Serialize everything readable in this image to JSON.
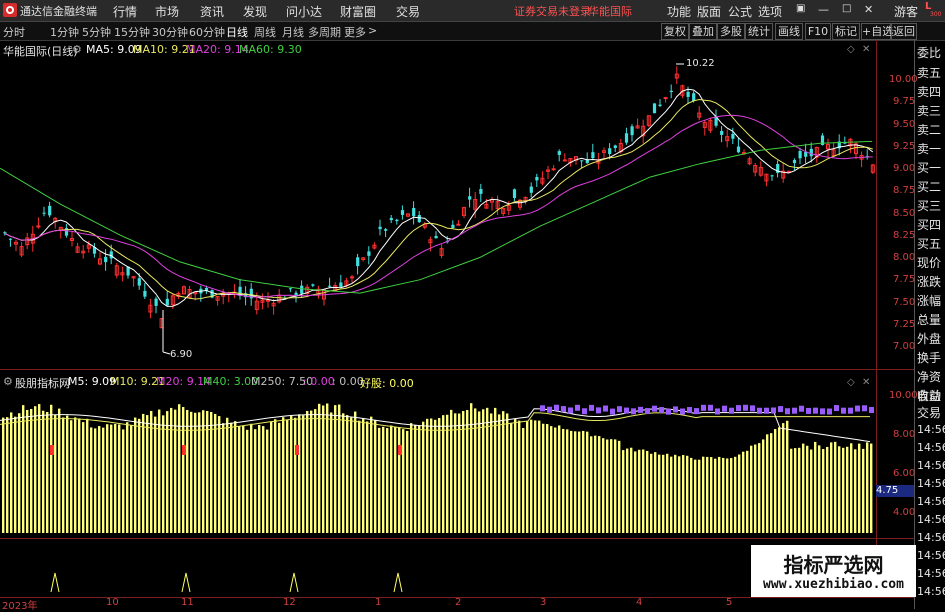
{
  "app": {
    "title": "通达信金融终端",
    "menu": [
      "行情",
      "市场",
      "资讯",
      "发现",
      "问小达",
      "财富圈",
      "交易"
    ],
    "status": "证券交易未登录",
    "stock_name": "华能国际",
    "right_menu": [
      "功能",
      "版面",
      "公式",
      "选项"
    ],
    "guest": "游客",
    "corner": "L",
    "corner_sub": "300"
  },
  "toolbar": {
    "periods": [
      "分时",
      "1分钟",
      "5分钟",
      "15分钟",
      "30分钟",
      "60分钟",
      "日线",
      "周线",
      "月线",
      "多周期",
      "更多"
    ],
    "active_period": "日线",
    "more_arrow": ">",
    "buttons": [
      "复权",
      "叠加",
      "多股",
      "统计",
      "画线",
      "F10",
      "标记",
      "+自选",
      "返回"
    ]
  },
  "main_panel": {
    "title": "华能国际(日线)",
    "ma": [
      {
        "label": "MA5: 9.09",
        "color": "#ffffff"
      },
      {
        "label": "MA10: 9.21",
        "color": "#e8e860"
      },
      {
        "label": "MA20: 9.14",
        "color": "#e040e0"
      },
      {
        "label": "MA60: 9.30",
        "color": "#40d040"
      }
    ],
    "high_label": "10.22",
    "low_label": "6.90",
    "axis": [
      "10.00",
      "9.75",
      "9.50",
      "9.25",
      "9.00",
      "8.75",
      "8.50",
      "8.25",
      "8.00",
      "7.75",
      "7.50",
      "7.25",
      "7.00"
    ]
  },
  "sub_panel": {
    "title": "股朋指标网",
    "items": [
      {
        "label": "M5: 9.09",
        "color": "#ffffff"
      },
      {
        "label": "M10: 9.21",
        "color": "#e8e860"
      },
      {
        "label": "M20: 9.14",
        "color": "#e040e0"
      },
      {
        "label": "M40: 3.00",
        "color": "#40d040"
      },
      {
        "label": "M250: 7.50",
        "color": "#c0c0c0"
      },
      {
        "label": ": 0.00",
        "color": "#e040e0"
      },
      {
        "label": ": 0.00",
        "color": "#c0c0c0"
      },
      {
        "label": "好股: 0.00",
        "color": "#ffff60"
      }
    ],
    "axis": [
      "10.00",
      "8.00",
      "6.00",
      "4.00"
    ],
    "current_value": "4.75"
  },
  "date_axis": [
    "2023年",
    "10",
    "11",
    "12",
    "1",
    "2",
    "3",
    "4",
    "5"
  ],
  "right_panel": {
    "labels": [
      "委比",
      "卖五",
      "卖四",
      "卖三",
      "卖二",
      "卖一",
      "买一",
      "买二",
      "买三",
      "买四",
      "买五",
      "现价",
      "涨跌",
      "涨幅",
      "总量",
      "外盘",
      "换手",
      "净资",
      "收益"
    ],
    "ticks": [
      "自动",
      "交易",
      "14:56",
      "14:56",
      "14:56",
      "14:56",
      "14:56",
      "14:56",
      "14:56",
      "14:56",
      "14:56",
      "14:56"
    ]
  },
  "watermark": {
    "title": "指标严选网",
    "url": "www.xuezhibiao.com"
  },
  "colors": {
    "up": "#ff3030",
    "down": "#40e0e0",
    "axis": "#d04040",
    "bar": "#ffff80"
  }
}
